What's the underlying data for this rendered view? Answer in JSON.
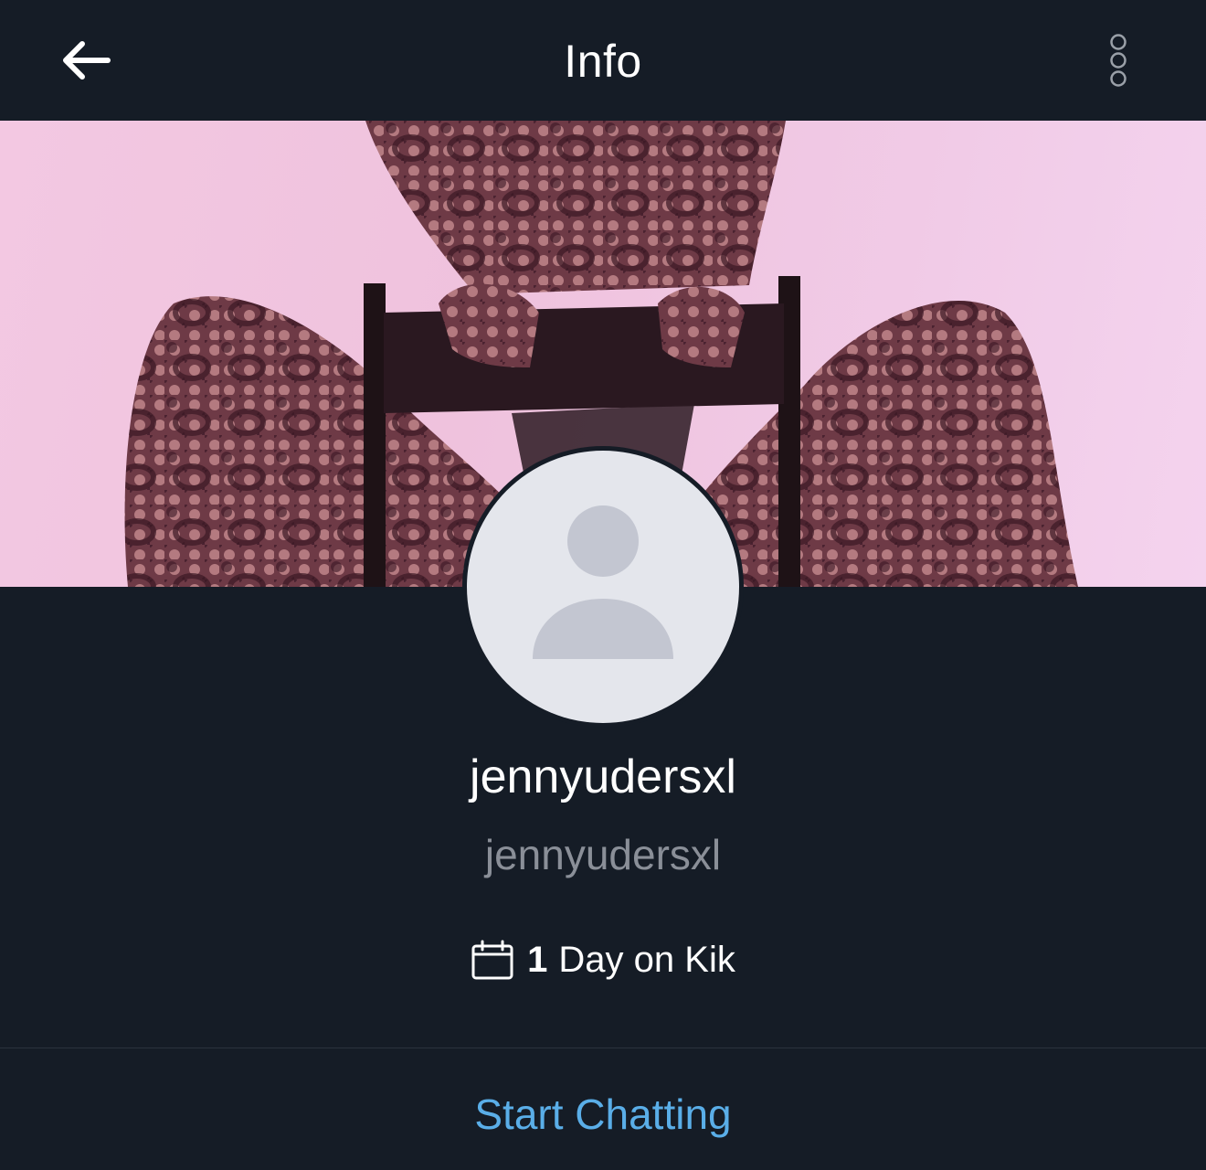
{
  "header": {
    "title": "Info",
    "back_icon": "arrow-left-icon",
    "more_icon": "more-vertical-icon"
  },
  "cover": {
    "description_icon": "cover-photo"
  },
  "profile": {
    "avatar_icon": "default-avatar-icon",
    "display_name": "jennyudersxl",
    "username": "jennyudersxl",
    "tenure_icon": "calendar-icon",
    "tenure_count": "1",
    "tenure_text": "Day on Kik"
  },
  "actions": {
    "start_chatting": "Start Chatting"
  },
  "colors": {
    "background": "#151c26",
    "accent": "#5aaee8",
    "secondary_text": "#8a8f98"
  }
}
